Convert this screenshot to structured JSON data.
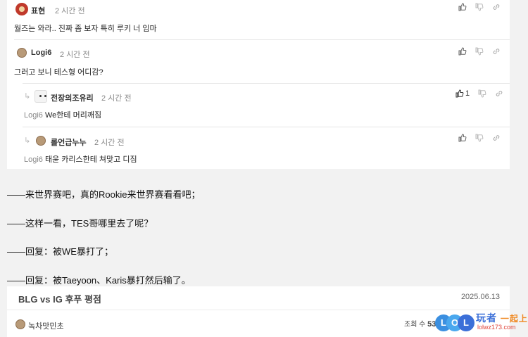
{
  "comments": [
    {
      "author": "표현",
      "time": "2 시간 전",
      "text": "월즈는 와라.. 진짜 좀 보자 특히 루키 너 임마",
      "likes": ""
    },
    {
      "author": "Logi6",
      "time": "2 시간 전",
      "text": "그러고 보니 테스형 어디감?",
      "likes": ""
    },
    {
      "author": "전장의조유리",
      "time": "2 시간 전",
      "mention": "Logi6",
      "text": "We한테 머리깨짐",
      "likes": "1"
    },
    {
      "author": "롤언급누누",
      "time": "2 시간 전",
      "mention": "Logi6",
      "text": "태윤 카리스한테 쳐맞고 디짐",
      "likes": ""
    }
  ],
  "translations": [
    "——来世界赛吧，真的Rookie来世界赛看看吧；",
    "——这样一看，TES哥哪里去了呢？",
    "——回复：被WE暴打了；",
    "——回复：被Taeyoon、Karis暴打然后输了。"
  ],
  "article": {
    "title": "BLG vs IG 후푸 평점",
    "date": "2025.06.13",
    "author": "녹차맛민초",
    "views_label": "조회 수",
    "views_value": "53"
  },
  "watermark": {
    "letters": [
      "L",
      "O",
      "L"
    ],
    "brand": "玩者",
    "brand_accent": "一起上",
    "url": "lolwz173.com"
  },
  "icons": {
    "like": "thumbs-up-icon",
    "dislike": "thumbs-down-icon",
    "link": "link-icon",
    "reply": "reply-arrow-icon"
  },
  "colors": {
    "mention": "#888888",
    "watermark_blue": "#3b6fd8",
    "watermark_orange": "#f08a24",
    "watermark_red": "#e0443a"
  }
}
